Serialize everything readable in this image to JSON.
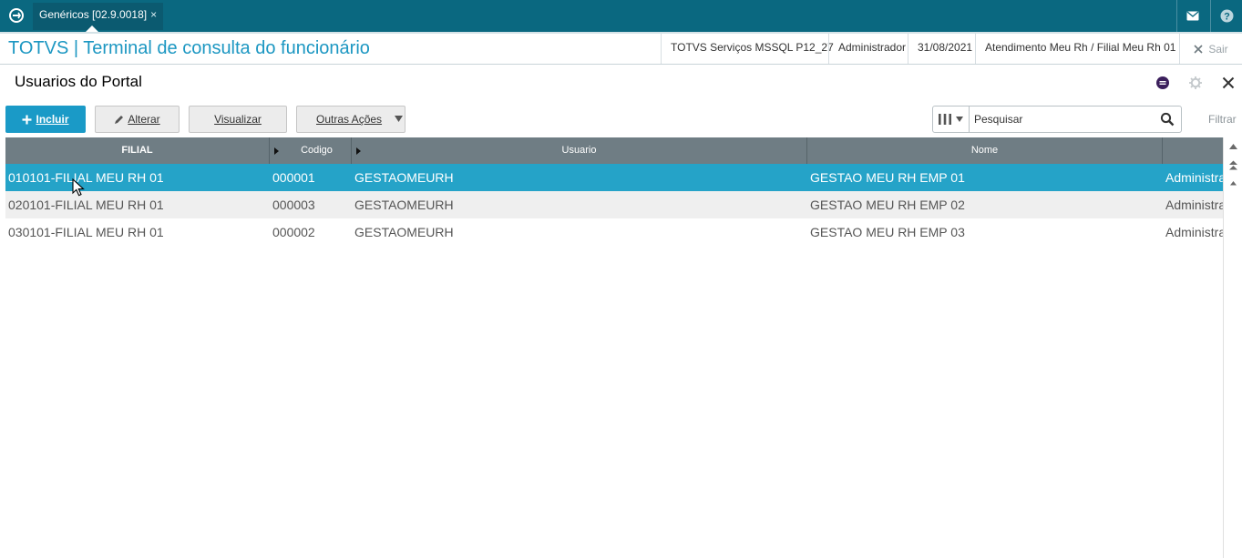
{
  "topbar": {
    "tab_label": "Genéricos [02.9.0018]",
    "tab_close": "×",
    "icons": [
      "refresh-icon",
      "mail-icon",
      "help-icon"
    ]
  },
  "titlebar": {
    "app_title": "TOTVS | Terminal de consulta do funcionário",
    "environment": "TOTVS Serviços MSSQL P12_27",
    "user": "Administrador",
    "date": "31/08/2021",
    "branch": "Atendimento Meu Rh / Filial Meu Rh 01",
    "exit_label": "Sair"
  },
  "page": {
    "title": "Usuarios do Portal"
  },
  "toolbar": {
    "incluir_label": "Incluir",
    "alterar_label": "Alterar",
    "visualizar_label": "Visualizar",
    "outras_label": "Outras Ações",
    "search_placeholder": "Pesquisar",
    "filter_label": "Filtrar"
  },
  "grid": {
    "columns": [
      "FILIAL",
      "Codigo",
      "Usuario",
      "Nome",
      ""
    ],
    "rows": [
      {
        "filial": "010101-FILIAL MEU RH 01",
        "codigo": "000001",
        "usuario": "GESTAOMEURH",
        "nome": "GESTAO MEU RH EMP 01",
        "extra": "Administra"
      },
      {
        "filial": "020101-FILIAL MEU RH 01",
        "codigo": "000003",
        "usuario": "GESTAOMEURH",
        "nome": "GESTAO MEU RH EMP 02",
        "extra": "Administra"
      },
      {
        "filial": "030101-FILIAL MEU RH 01",
        "codigo": "000002",
        "usuario": "GESTAOMEURH",
        "nome": "GESTAO MEU RH EMP 03",
        "extra": "Administra"
      }
    ],
    "selected_row": 0
  },
  "colors": {
    "topbar": "#0a6880",
    "accent": "#1a9ac7",
    "selected_row": "#25a3c8",
    "grid_header": "#6f7d84"
  }
}
